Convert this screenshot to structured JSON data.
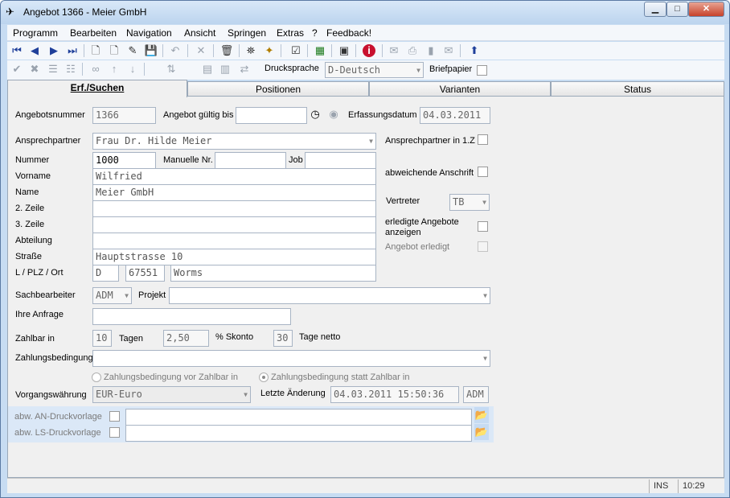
{
  "window": {
    "title": "Angebot 1366 - Meier GmbH",
    "minimize": "▁",
    "maximize": "□",
    "close": "✕"
  },
  "menu": [
    "Programm",
    "Bearbeiten",
    "Navigation",
    "Ansicht",
    "Springen",
    "Extras",
    "?",
    "Feedback!"
  ],
  "toolbar": {
    "druck_label": "Drucksprache",
    "druck_value": "D-Deutsch",
    "briefpapier_label": "Briefpapier"
  },
  "tabs": [
    "Erf./Suchen",
    "Positionen",
    "Varianten",
    "Status"
  ],
  "form": {
    "angebotsnummer_label": "Angebotsnummer",
    "angebotsnummer": "1366",
    "gueltig_label": "Angebot gültig bis",
    "gueltig_value": "",
    "erfassungsdatum_label": "Erfassungsdatum",
    "erfassungsdatum": "04.03.2011",
    "ansprechpartner_label": "Ansprechpartner",
    "ansprechpartner": "Frau Dr. Hilde Meier",
    "nummer_label": "Nummer",
    "nummer": "1000",
    "manuelle_label": "Manuelle Nr.",
    "manuelle": "",
    "job_label": "Job",
    "job": "",
    "vorname_label": "Vorname",
    "vorname": "Wilfried",
    "name_label": "Name",
    "name": "Meier GmbH",
    "zeile2_label": "2. Zeile",
    "zeile3_label": "3. Zeile",
    "abteilung_label": "Abteilung",
    "strasse_label": "Straße",
    "strasse": "Hauptstrasse 10",
    "ort_label": "L / PLZ / Ort",
    "land": "D",
    "plz": "67551",
    "ort": "Worms",
    "sachbearbeiter_label": "Sachbearbeiter",
    "sachbearbeiter": "ADM",
    "projekt_label": "Projekt",
    "anfrage_label": "Ihre Anfrage",
    "zahlbar_label": "Zahlbar in",
    "zahlbar_tage": "10",
    "tagen_label": "Tagen",
    "skonto_value": "2,50",
    "skonto_label": "%  Skonto",
    "netto_tage": "30",
    "netto_label": "Tage netto",
    "zahlungsbedingung_label": "Zahlungsbedingung",
    "radio_vor": "Zahlungsbedingung vor Zahlbar in",
    "radio_statt": "Zahlungsbedingung statt Zahlbar in",
    "waehrung_label": "Vorgangswährung",
    "waehrung": "EUR-Euro",
    "letzte_label": "Letzte Änderung",
    "letzte_value": "04.03.2011 15:50:36",
    "letzte_user": "ADM",
    "an_druck_label": "abw. AN-Druckvorlage",
    "ls_druck_label": "abw. LS-Druckvorlage",
    "ap_1z_label": "Ansprechpartner in 1.Z",
    "abw_anschrift_label": "abweichende Anschrift",
    "vertreter_label": "Vertreter",
    "vertreter": "TB",
    "erledigte_label": "erledigte Angebote anzeigen",
    "erledigt_label": "Angebot erledigt"
  },
  "status": {
    "ins": "INS",
    "time": "10:29"
  }
}
